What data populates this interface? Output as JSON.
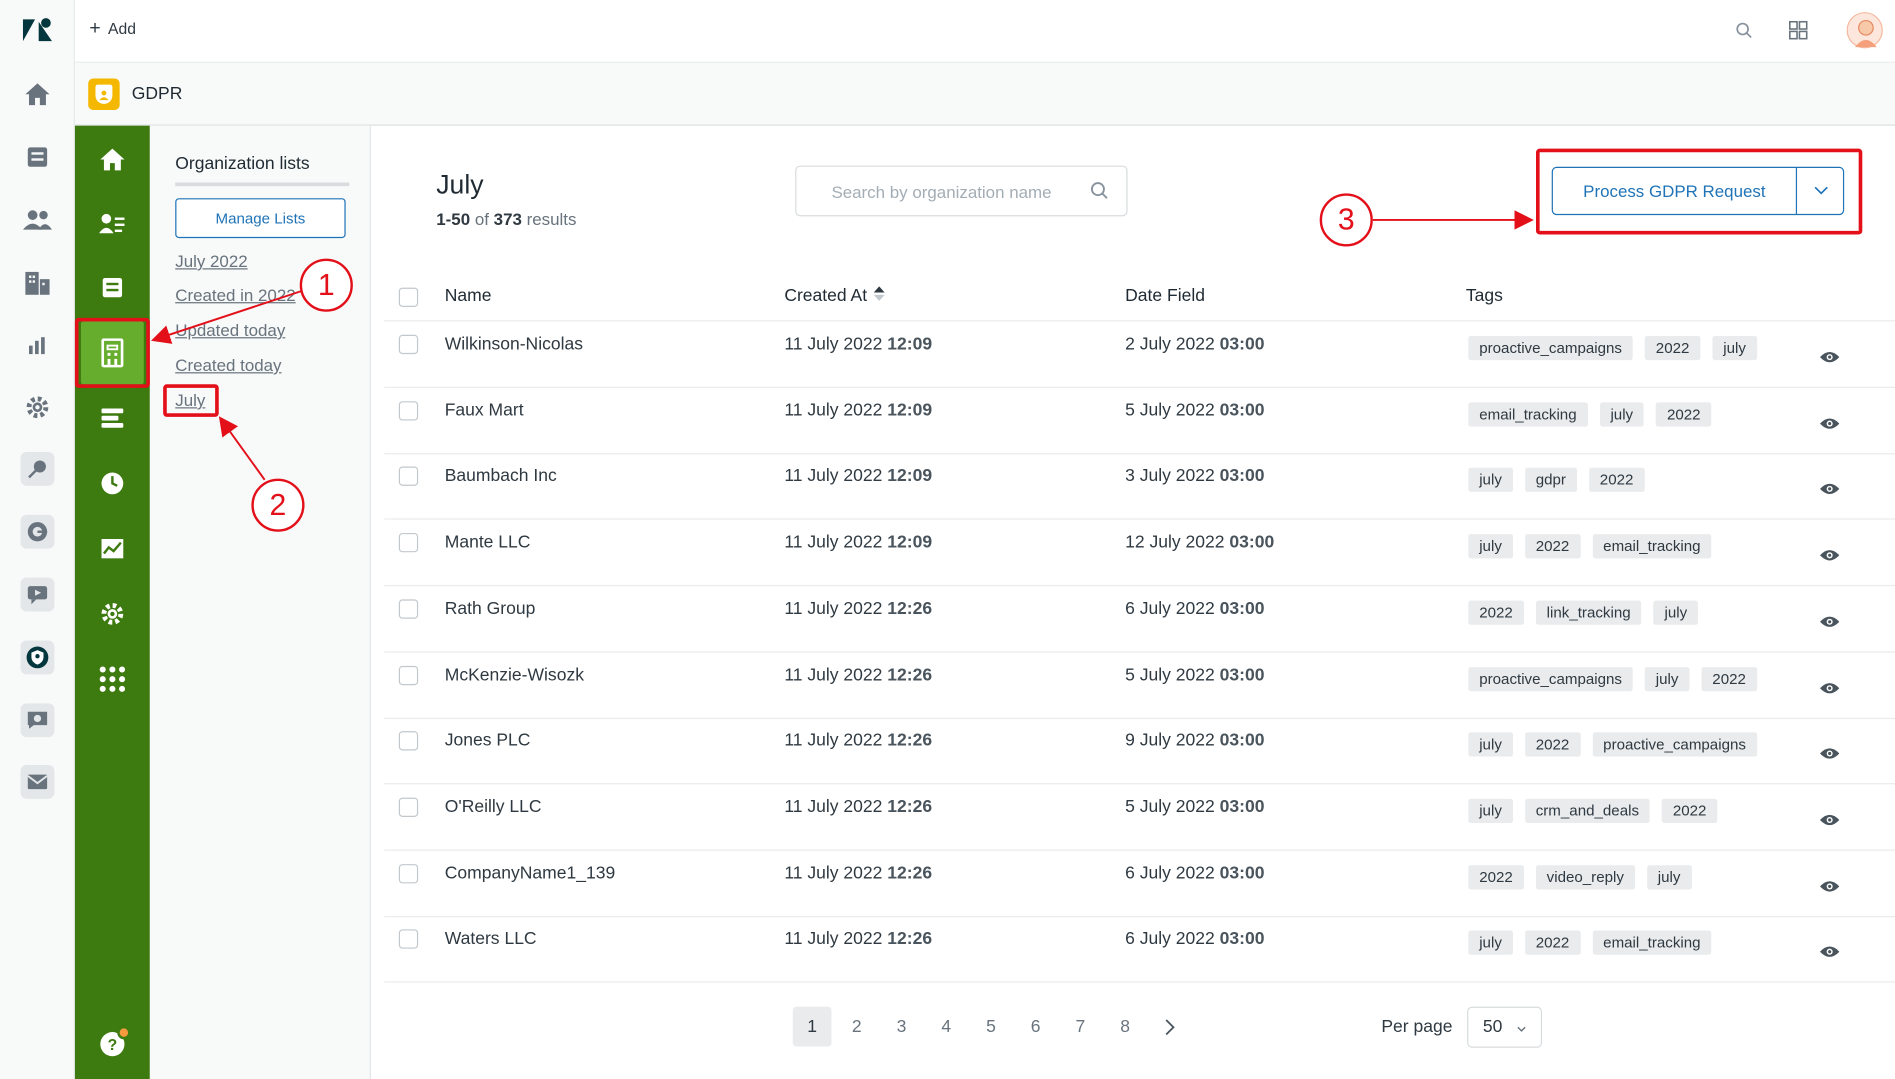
{
  "topbar": {
    "add_label": "Add"
  },
  "app": {
    "name": "GDPR"
  },
  "rail_icons": [
    "home-icon",
    "tickets-icon",
    "users-icon",
    "organizations-icon",
    "reporting-icon",
    "admin-gear-icon",
    "explore-icon",
    "guide-icon",
    "chat-icon",
    "gdpr-shield-icon",
    "answer-bot-icon",
    "mail-icon"
  ],
  "green_nav_icons": [
    "home-icon",
    "contacts-icon",
    "inbox-icon",
    "organization-lists-icon",
    "list-icon",
    "history-icon",
    "chart-icon",
    "settings-icon",
    "apps-grid-icon"
  ],
  "lists_panel": {
    "title": "Organization lists",
    "manage_label": "Manage Lists",
    "items": [
      "July 2022",
      "Created in 2022",
      "Updated today",
      "Created today",
      "July"
    ]
  },
  "main": {
    "title": "July",
    "results_range": "1-50",
    "results_of": "of",
    "results_total": "373",
    "results_suffix": "results",
    "search_placeholder": "Search by organization name",
    "process_button": "Process GDPR Request"
  },
  "table": {
    "headers": {
      "name": "Name",
      "created_at": "Created At",
      "date_field": "Date Field",
      "tags": "Tags"
    },
    "rows": [
      {
        "name": "Wilkinson-Nicolas",
        "created_date": "11 July 2022",
        "created_time": "12:09",
        "field_date": "2 July 2022",
        "field_time": "03:00",
        "tags": [
          "proactive_campaigns",
          "2022",
          "july"
        ]
      },
      {
        "name": "Faux Mart",
        "created_date": "11 July 2022",
        "created_time": "12:09",
        "field_date": "5 July 2022",
        "field_time": "03:00",
        "tags": [
          "email_tracking",
          "july",
          "2022"
        ]
      },
      {
        "name": "Baumbach Inc",
        "created_date": "11 July 2022",
        "created_time": "12:09",
        "field_date": "3 July 2022",
        "field_time": "03:00",
        "tags": [
          "july",
          "gdpr",
          "2022"
        ]
      },
      {
        "name": "Mante LLC",
        "created_date": "11 July 2022",
        "created_time": "12:09",
        "field_date": "12 July 2022",
        "field_time": "03:00",
        "tags": [
          "july",
          "2022",
          "email_tracking"
        ]
      },
      {
        "name": "Rath Group",
        "created_date": "11 July 2022",
        "created_time": "12:26",
        "field_date": "6 July 2022",
        "field_time": "03:00",
        "tags": [
          "2022",
          "link_tracking",
          "july"
        ]
      },
      {
        "name": "McKenzie-Wisozk",
        "created_date": "11 July 2022",
        "created_time": "12:26",
        "field_date": "5 July 2022",
        "field_time": "03:00",
        "tags": [
          "proactive_campaigns",
          "july",
          "2022"
        ]
      },
      {
        "name": "Jones PLC",
        "created_date": "11 July 2022",
        "created_time": "12:26",
        "field_date": "9 July 2022",
        "field_time": "03:00",
        "tags": [
          "july",
          "2022",
          "proactive_campaigns"
        ]
      },
      {
        "name": "O'Reilly LLC",
        "created_date": "11 July 2022",
        "created_time": "12:26",
        "field_date": "5 July 2022",
        "field_time": "03:00",
        "tags": [
          "july",
          "crm_and_deals",
          "2022"
        ]
      },
      {
        "name": "CompanyName1_139",
        "created_date": "11 July 2022",
        "created_time": "12:26",
        "field_date": "6 July 2022",
        "field_time": "03:00",
        "tags": [
          "2022",
          "video_reply",
          "july"
        ]
      },
      {
        "name": "Waters LLC",
        "created_date": "11 July 2022",
        "created_time": "12:26",
        "field_date": "6 July 2022",
        "field_time": "03:00",
        "tags": [
          "july",
          "2022",
          "email_tracking"
        ]
      }
    ]
  },
  "pagination": {
    "pages": [
      "1",
      "2",
      "3",
      "4",
      "5",
      "6",
      "7",
      "8"
    ],
    "current": "1",
    "per_page_label": "Per page",
    "per_page_value": "50"
  },
  "annotations": {
    "step1": "1",
    "step2": "2",
    "step3": "3",
    "color": "#e3101a"
  },
  "colors": {
    "green_nav": "#3d7a0f",
    "green_active": "#67ad2d",
    "accent_blue": "#1f73b7",
    "app_icon_yellow": "#f5b800"
  }
}
